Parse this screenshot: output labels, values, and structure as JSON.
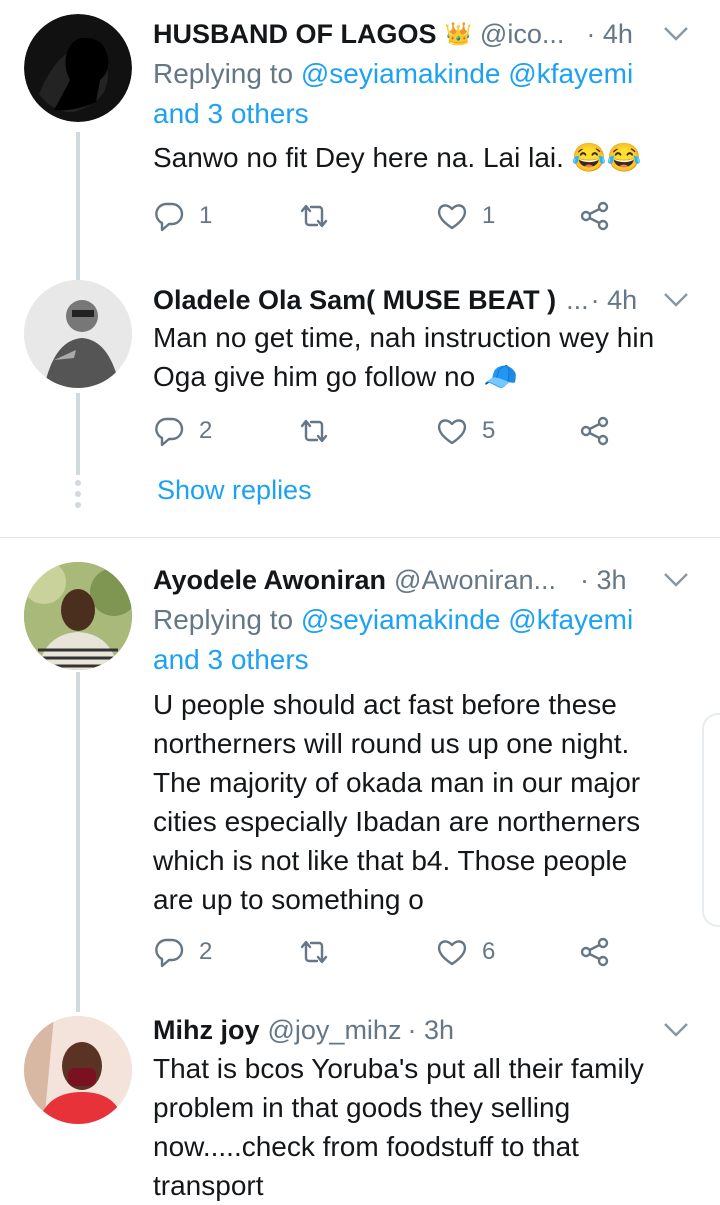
{
  "tweets": [
    {
      "name": "HUSBAND OF LAGOS",
      "badge": "👑",
      "handle": "@ico...",
      "time": "· 4h",
      "reply_prefix": "Replying to ",
      "reply_links": "@seyiamakinde @kfayemi",
      "reply_more": "and 3 others",
      "text": "Sanwo no fit Dey here na. Lai lai. 😂😂",
      "replies": "1",
      "retweets": "",
      "likes": "1"
    },
    {
      "name": "Oladele Ola Sam( MUSE BEAT )",
      "handle": "...",
      "time": "· 4h",
      "text_lines": [
        "Man no get time, nah instruction wey hin",
        "Oga give him go follow no 🧢"
      ],
      "replies": "2",
      "retweets": "",
      "likes": "5",
      "show_replies": "Show replies"
    },
    {
      "name": "Ayodele Awoniran",
      "handle": "@Awoniran...",
      "time": "· 3h",
      "reply_prefix": "Replying to ",
      "reply_links": "@seyiamakinde @kfayemi",
      "reply_more": "and 3 others",
      "text_lines": [
        "U people should act fast before these",
        "northerners will round us up one night.",
        "The majority of okada man in our major",
        "cities especially Ibadan are northerners",
        "which is not like that b4. Those people",
        "are up to something o"
      ],
      "replies": "2",
      "retweets": "",
      "likes": "6"
    },
    {
      "name": "Mihz joy",
      "handle": "@joy_mihz",
      "time": "· 3h",
      "text_lines": [
        "That is bcos Yoruba's put all their family",
        "problem in that goods they selling",
        "now.....check from foodstuff to that",
        "transport"
      ]
    }
  ],
  "icons": {
    "reply": "reply-icon",
    "retweet": "retweet-icon",
    "like": "heart-icon",
    "share": "share-icon",
    "more": "chevron-down-icon"
  },
  "colors": {
    "link": "#1da1f2",
    "secondary": "#657786",
    "thread": "#cfd9de"
  }
}
